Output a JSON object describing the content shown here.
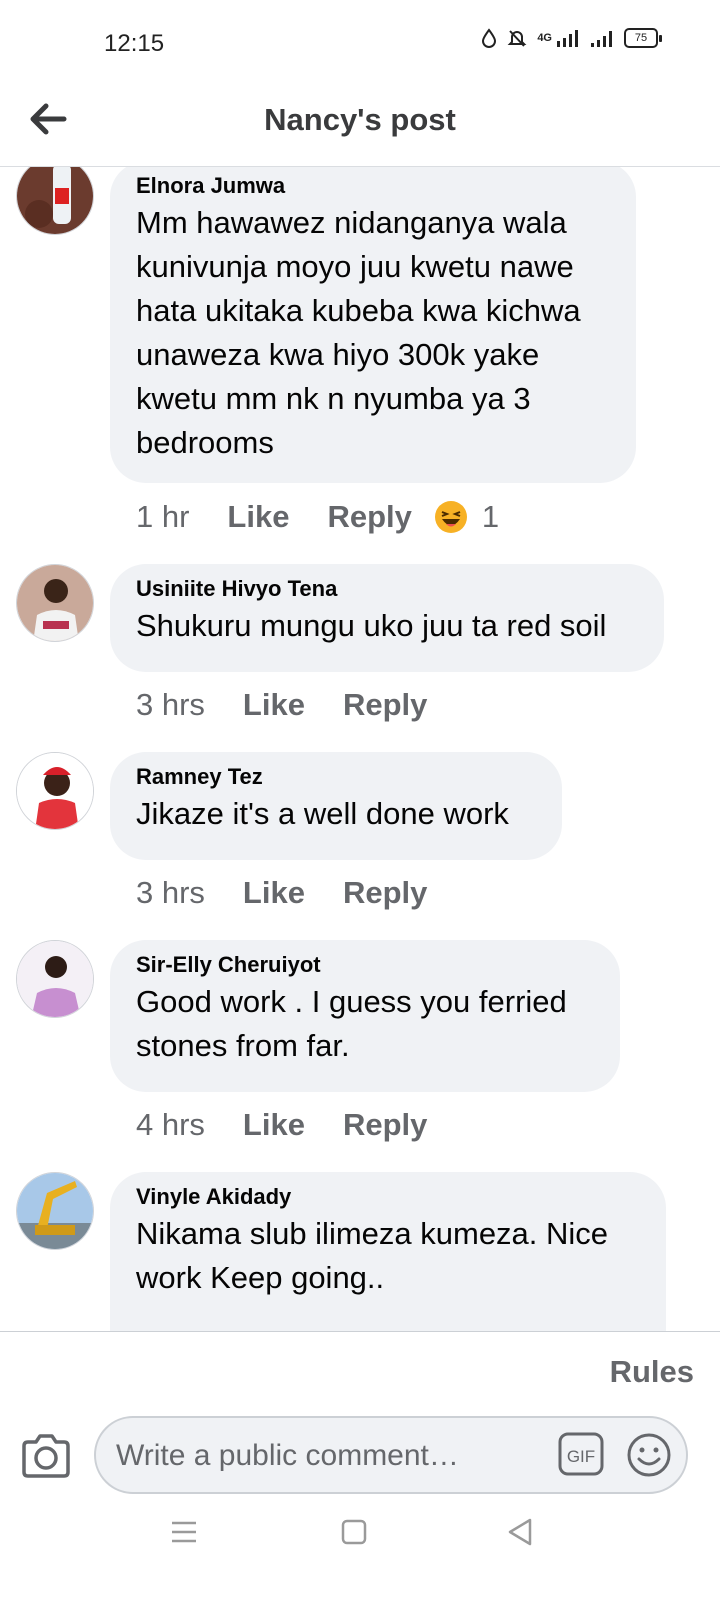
{
  "status_bar": {
    "time": "12:15",
    "network": "4G",
    "battery": "75"
  },
  "header": {
    "title": "Nancy's post",
    "back_icon": "arrow-left-icon"
  },
  "comments": [
    {
      "author": "Elnora Jumwa",
      "lines": [
        "Mm hawawez nidanganya wala",
        "kunivunja moyo juu kwetu nawe",
        "hata ukitaka kubeba kwa kichwa",
        "unaweza  kwa hiyo 300k yake",
        "kwetu mm nk n nyumba ya 3",
        "bedrooms"
      ],
      "time": "1 hr",
      "like": "Like",
      "reply": "Reply",
      "reaction_icon": "haha-emoji-icon",
      "reaction_count": "1"
    },
    {
      "author": "Usiniite Hivyo Tena",
      "lines": [
        "Shukuru mungu uko juu ta red soil"
      ],
      "time": "3 hrs",
      "like": "Like",
      "reply": "Reply"
    },
    {
      "author": "Ramney Tez",
      "lines": [
        "Jikaze it's a well done work"
      ],
      "time": "3 hrs",
      "like": "Like",
      "reply": "Reply"
    },
    {
      "author": "Sir-Elly Cheruiyot",
      "lines": [
        "Good work . I guess you ferried",
        "stones from far."
      ],
      "time": "4 hrs",
      "like": "Like",
      "reply": "Reply"
    },
    {
      "author": "Vinyle Akidady",
      "lines": [
        "Nikama slub ilimeza kumeza. Nice",
        "work Keep going.."
      ]
    }
  ],
  "footer": {
    "rules": "Rules",
    "placeholder": "Write a public comment…",
    "gif_label": "GIF",
    "camera_icon": "camera-icon",
    "emoji_icon": "smiley-icon"
  },
  "colors": {
    "bubble": "#f0f2f5",
    "meta_text": "#65676b",
    "header_text": "#3a3b3d"
  }
}
